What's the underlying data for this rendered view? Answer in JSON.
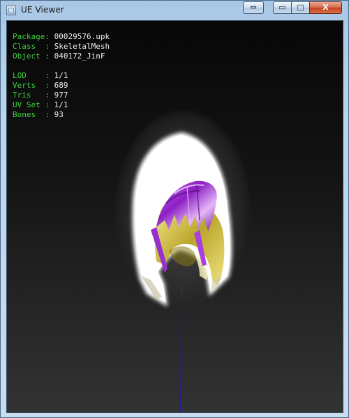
{
  "window": {
    "title": "UE Viewer",
    "buttons": {
      "resize": "⇔",
      "minimize": "▭",
      "maximize": "□",
      "close": "X"
    }
  },
  "info": {
    "package": {
      "label": "Package:",
      "value": "00029576.upk"
    },
    "class": {
      "label": "Class  :",
      "value": "SkeletalMesh"
    },
    "object": {
      "label": "Object :",
      "value": "040172_JinF"
    },
    "lod": {
      "label": "LOD    :",
      "value": "1/1"
    },
    "verts": {
      "label": "Verts  :",
      "value": "689"
    },
    "tris": {
      "label": "Tris   :",
      "value": "977"
    },
    "uvset": {
      "label": "UV Set :",
      "value": "1/1"
    },
    "bones": {
      "label": "Bones  :",
      "value": "93"
    }
  },
  "colors": {
    "info_label": "#3ecf3e",
    "info_value": "#ececec",
    "axis_line": "#1a1ab8",
    "hair": "#9a2fd0",
    "mesh_white": "#ffffff",
    "mesh_gold": "#d8c34a"
  }
}
